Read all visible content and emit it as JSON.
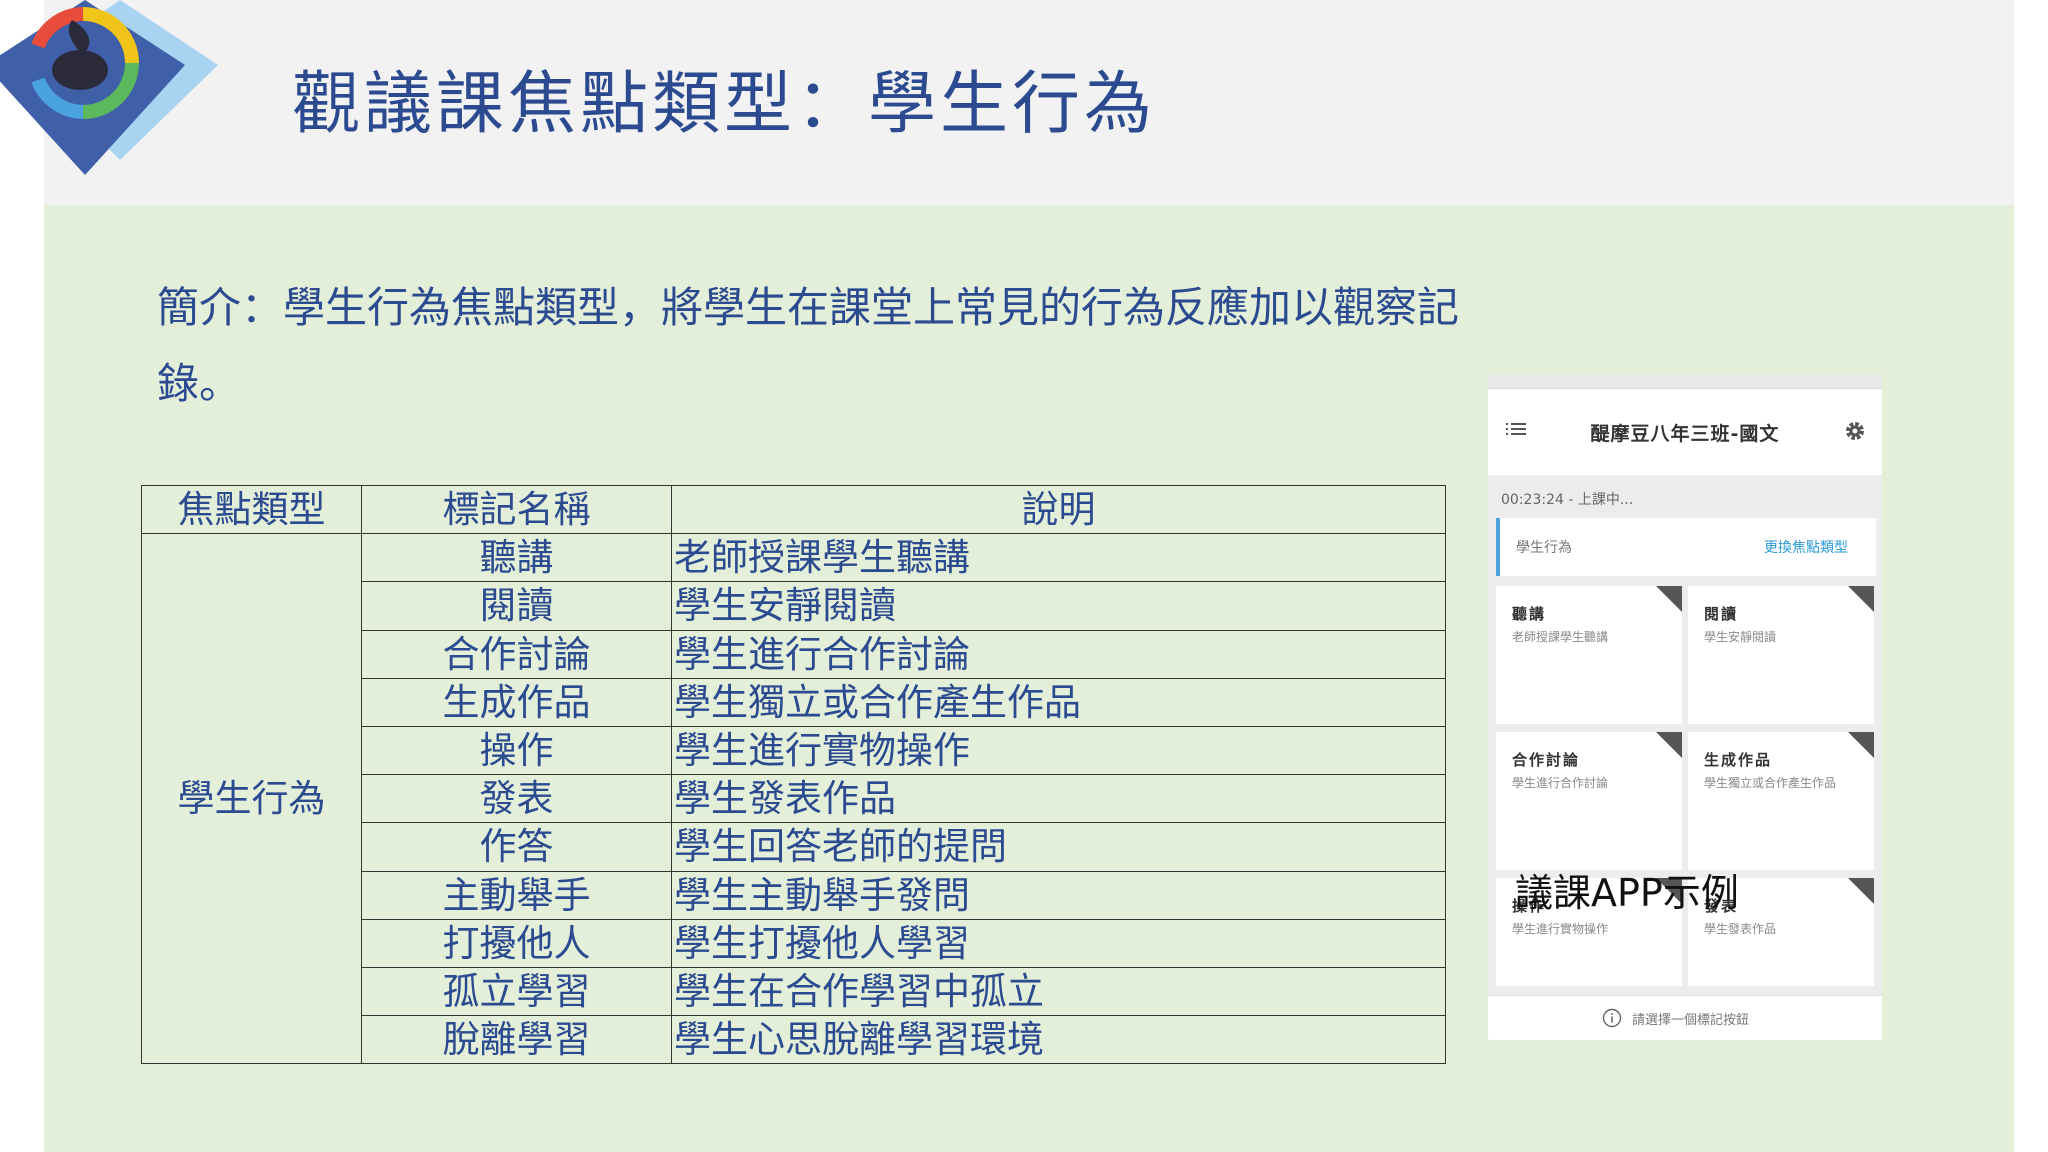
{
  "page": {
    "title": "觀議課焦點類型：學生行為",
    "intro": "簡介：學生行為焦點類型，將學生在課堂上常見的行為反應加以觀察記錄。"
  },
  "table": {
    "headers": [
      "焦點類型",
      "標記名稱",
      "說明"
    ],
    "focus_type": "學生行為",
    "rows": [
      {
        "name": "聽講",
        "desc": "老師授課學生聽講"
      },
      {
        "name": "閱讀",
        "desc": "學生安靜閱讀"
      },
      {
        "name": "合作討論",
        "desc": "學生進行合作討論"
      },
      {
        "name": "生成作品",
        "desc": "學生獨立或合作產生作品"
      },
      {
        "name": "操作",
        "desc": "學生進行實物操作"
      },
      {
        "name": "發表",
        "desc": "學生發表作品"
      },
      {
        "name": "作答",
        "desc": "學生回答老師的提問"
      },
      {
        "name": "主動舉手",
        "desc": "學生主動舉手發問"
      },
      {
        "name": "打擾他人",
        "desc": "學生打擾他人學習"
      },
      {
        "name": "孤立學習",
        "desc": "學生在合作學習中孤立"
      },
      {
        "name": "脫離學習",
        "desc": "學生心思脫離學習環境"
      }
    ]
  },
  "app": {
    "title": "醍摩豆八年三班-國文",
    "status": "00:23:24 - 上課中...",
    "focus_label": "學生行為",
    "change_link": "更換焦點類型",
    "cards": [
      {
        "title": "聽講",
        "desc": "老師授課學生聽講"
      },
      {
        "title": "閱讀",
        "desc": "學生安靜閱讀"
      },
      {
        "title": "合作討論",
        "desc": "學生進行合作討論"
      },
      {
        "title": "生成作品",
        "desc": "學生獨立或合作產生作品"
      },
      {
        "title": "操作",
        "desc": "學生進行實物操作"
      },
      {
        "title": "發表",
        "desc": "學生發表作品"
      }
    ],
    "footer_hint": "請選擇一個標記按鈕",
    "caption": "議課APP示例"
  },
  "icons": {
    "logo": "logo-icon",
    "menu": "menu-icon",
    "settings": "gear-icon",
    "info": "info-icon"
  },
  "colors": {
    "title": "#2b4a8f",
    "header_bg": "#f2f2f2",
    "content_bg": "#e3efd9",
    "accent_blue": "#2a9ad8"
  }
}
